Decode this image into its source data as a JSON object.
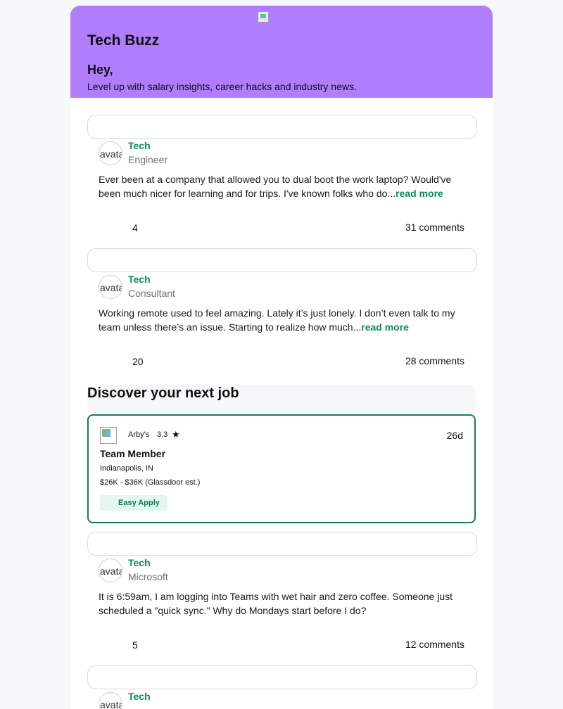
{
  "header": {
    "brand": "Tech Buzz",
    "greeting": "Hey,",
    "tagline": "Level up with salary insights, career hacks and industry news."
  },
  "posts": [
    {
      "bowl": "Tech",
      "role": "Engineer",
      "avatar_alt": "avatar",
      "body": "Ever been at a company that allowed you to dual boot the work laptop? Would've been much nicer for learning and for trips. I've known folks who do...",
      "read_more": "read more",
      "likes": "4",
      "comments": "31 comments"
    },
    {
      "bowl": "Tech",
      "role": "Consultant",
      "avatar_alt": "avatar",
      "body": "Working remote used to feel amazing. Lately it’s just lonely. I don’t even talk to my team unless there’s an issue. Starting to realize how much...",
      "read_more": "read more",
      "likes": "20",
      "comments": "28 comments"
    },
    {
      "bowl": "Tech",
      "role": "Microsoft",
      "avatar_alt": "avatar",
      "body": "It is 6:59am, I am logging into Teams with wet hair and zero coffee. Someone just scheduled a \"quick sync.\" Why do Mondays start before I do?",
      "likes": "5",
      "comments": "12 comments"
    },
    {
      "bowl": "Tech",
      "avatar_alt": "avatar"
    }
  ],
  "discover": {
    "title": "Discover your next job"
  },
  "job": {
    "company": "Arby's",
    "rating": "3.3",
    "star": "★",
    "age": "26d",
    "title": "Team Member",
    "location": "Indianapolis, IN",
    "salary": "$26K - $36K (Glassdoor est.)",
    "apply_label": "Easy Apply"
  },
  "colors": {
    "header_bg": "#b07dfc",
    "accent_green": "#0b8a5f",
    "job_border": "#1a7a5c"
  }
}
